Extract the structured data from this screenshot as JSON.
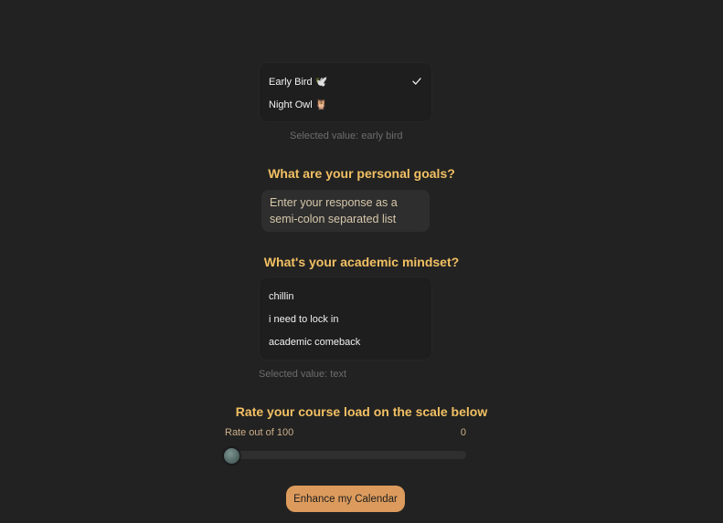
{
  "chronotype": {
    "options": [
      {
        "label": "Early Bird 🕊️",
        "selected": true
      },
      {
        "label": "Night Owl 🦉",
        "selected": false
      }
    ],
    "selected_text": "Selected value: early bird"
  },
  "goals": {
    "heading": "What are your personal goals?",
    "placeholder": "Enter your response as a\nsemi-colon separated list"
  },
  "mindset": {
    "heading": "What's your academic mindset?",
    "options": [
      {
        "label": "chillin"
      },
      {
        "label": "i need to lock in"
      },
      {
        "label": "academic comeback"
      }
    ],
    "selected_text": "Selected value: text"
  },
  "course_load": {
    "heading": "Rate your course load on the scale below",
    "label": "Rate out of 100",
    "value": "0",
    "max": 100
  },
  "cta": {
    "label": "Enhance my Calendar"
  },
  "colors": {
    "background": "#222222",
    "accent": "#f2c063",
    "button": "#dc9b5d"
  }
}
